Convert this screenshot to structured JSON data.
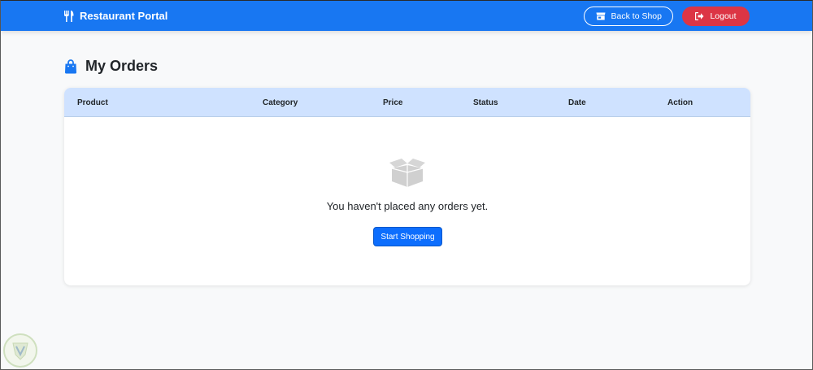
{
  "navbar": {
    "brand": "Restaurant Portal",
    "brand_icon": "utensils-icon",
    "back_to_shop": "Back to Shop",
    "back_icon": "store-icon",
    "logout": "Logout",
    "logout_icon": "sign-out-icon"
  },
  "page": {
    "title": "My Orders",
    "title_icon": "shopping-bag-icon"
  },
  "table": {
    "columns": [
      "Product",
      "Category",
      "Price",
      "Status",
      "Date",
      "Action"
    ],
    "empty_icon": "open-box-icon",
    "empty_message": "You haven't placed any orders yet.",
    "start_shopping": "Start Shopping"
  },
  "colors": {
    "navbar": "#1877f2",
    "danger": "#dc3545",
    "primary": "#0d6efd",
    "table_header": "#cfe2ff"
  }
}
